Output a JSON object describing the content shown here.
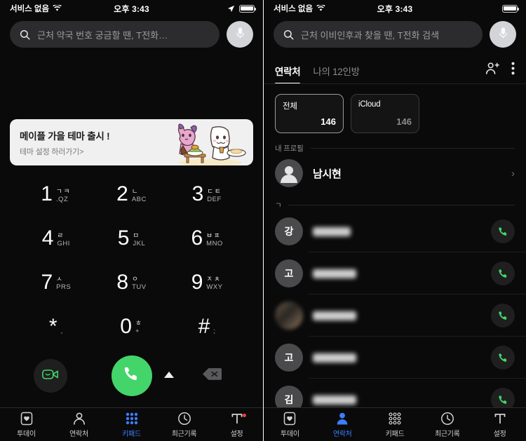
{
  "left": {
    "status": {
      "carrier": "서비스 없음",
      "time": "오후 3:43",
      "wifi_icon": "wifi-icon",
      "location_icon": "location-arrow-icon",
      "battery_icon": "battery-icon"
    },
    "search": {
      "placeholder": "근처 약국 번호 궁금할 땐, T전화…",
      "icon": "search-icon",
      "mic_icon": "microphone-icon"
    },
    "banner": {
      "title": "메이플 가을 테마 출시 !",
      "subtitle": "테마 설정 하러가기>"
    },
    "keypad": [
      {
        "digit": "1",
        "jamo": "ㄱㅋ",
        "latin": ".QZ"
      },
      {
        "digit": "2",
        "jamo": "ㄴ",
        "latin": "ABC"
      },
      {
        "digit": "3",
        "jamo": "ㄷㅌ",
        "latin": "DEF"
      },
      {
        "digit": "4",
        "jamo": "ㄹ",
        "latin": "GHI"
      },
      {
        "digit": "5",
        "jamo": "ㅁ",
        "latin": "JKL"
      },
      {
        "digit": "6",
        "jamo": "ㅂㅍ",
        "latin": "MNO"
      },
      {
        "digit": "7",
        "jamo": "ㅅ",
        "latin": "PRS"
      },
      {
        "digit": "8",
        "jamo": "ㅇ",
        "latin": "TUV"
      },
      {
        "digit": "9",
        "jamo": "ㅈㅊ",
        "latin": "WXY"
      },
      {
        "digit": "*",
        "jamo": "",
        "latin": ","
      },
      {
        "digit": "0",
        "jamo": "ㅎ",
        "latin": "+"
      },
      {
        "digit": "#",
        "jamo": "",
        "latin": ";"
      }
    ],
    "actions": {
      "video_icon": "video-call-icon",
      "call_icon": "phone-call-icon",
      "expand_icon": "triangle-up-icon",
      "backspace_icon": "backspace-icon"
    },
    "tabbar": [
      {
        "label": "투데이",
        "icon": "today-heart-icon",
        "active": false,
        "badge": false
      },
      {
        "label": "연락처",
        "icon": "contacts-person-icon",
        "active": false,
        "badge": false
      },
      {
        "label": "키패드",
        "icon": "keypad-dots-icon",
        "active": true,
        "badge": false
      },
      {
        "label": "최근기록",
        "icon": "clock-icon",
        "active": false,
        "badge": false
      },
      {
        "label": "설정",
        "icon": "t-settings-icon",
        "active": false,
        "badge": true
      }
    ]
  },
  "right": {
    "status": {
      "carrier": "서비스 없음",
      "time": "오후 3:43",
      "wifi_icon": "wifi-icon",
      "battery_icon": "battery-icon"
    },
    "search": {
      "placeholder": "근처 이비인후과 찾을 땐, T전화 검색",
      "icon": "search-icon",
      "mic_icon": "microphone-icon"
    },
    "tabs": [
      {
        "label": "연락처",
        "active": true
      },
      {
        "label": "나의 12인방",
        "active": false
      }
    ],
    "tab_actions": {
      "add_contact_icon": "add-person-icon",
      "more_icon": "overflow-menu-icon"
    },
    "cards": [
      {
        "name": "전체",
        "count": "146",
        "selected": true
      },
      {
        "name": "iCloud",
        "count": "146",
        "selected": false
      }
    ],
    "profile_section": "내 프로필",
    "profile": {
      "name": "남시현",
      "avatar_icon": "person-avatar-icon",
      "chevron": "›"
    },
    "letter_section": "ㄱ",
    "contacts": [
      {
        "initial": "강",
        "name": "",
        "photo": false,
        "call_icon": "phone-call-icon"
      },
      {
        "initial": "고",
        "name": "",
        "photo": false,
        "call_icon": "phone-call-icon"
      },
      {
        "initial": "",
        "name": "",
        "photo": true,
        "call_icon": "phone-call-icon"
      },
      {
        "initial": "고",
        "name": "",
        "photo": false,
        "call_icon": "phone-call-icon"
      },
      {
        "initial": "김",
        "name": "",
        "photo": false,
        "call_icon": "phone-call-icon"
      }
    ],
    "tabbar": [
      {
        "label": "투데이",
        "icon": "today-heart-icon",
        "active": false,
        "badge": false
      },
      {
        "label": "연락처",
        "icon": "contacts-person-icon",
        "active": true,
        "badge": false
      },
      {
        "label": "키패드",
        "icon": "keypad-dots-icon",
        "active": false,
        "badge": false
      },
      {
        "label": "최근기록",
        "icon": "clock-icon",
        "active": false,
        "badge": false
      },
      {
        "label": "설정",
        "icon": "t-settings-icon",
        "active": false,
        "badge": false
      }
    ]
  },
  "colors": {
    "accent_blue": "#3d7eff",
    "call_green": "#43d56a",
    "badge_red": "#ff3b30",
    "bg": "#0a0a0a"
  }
}
